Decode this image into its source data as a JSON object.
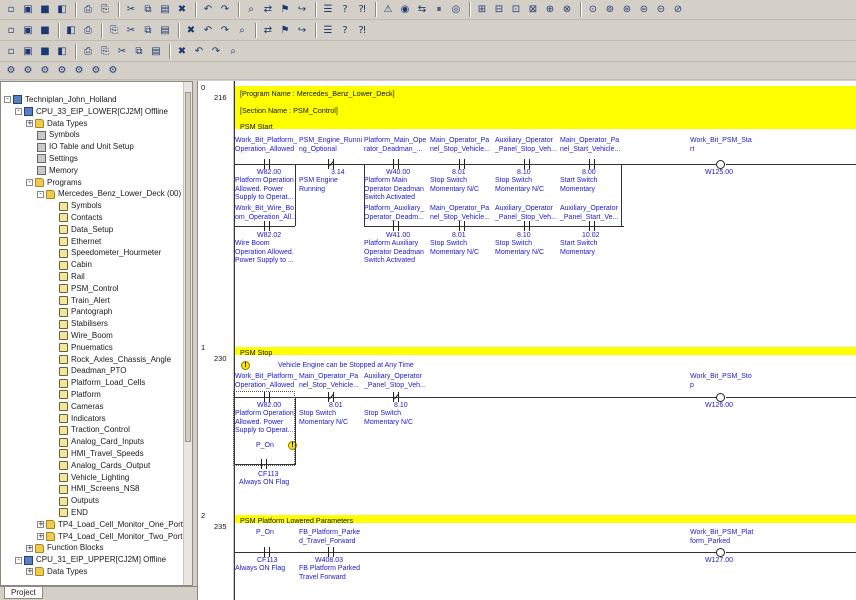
{
  "toolbars": {
    "row1": [
      "new-icon",
      "open-icon",
      "save-icon",
      "print-preview-icon",
      "print-icon",
      "print-setup-icon",
      "cut-icon",
      "copy-icon",
      "paste-icon",
      "delete-icon",
      "undo-icon",
      "redo-icon",
      "find-icon",
      "replace-icon",
      "cross-ref-icon",
      "jump-icon",
      "properties-icon",
      "help-icon",
      "whats-this-icon",
      "warning-icon",
      "monitor-icon",
      "work-online-icon",
      "pause-icon",
      "watch-icon",
      "toggle-a-icon",
      "toggle-b-icon",
      "toggle-c-icon",
      "toggle-d-icon",
      "toggle-e-icon",
      "toggle-f-icon",
      "toggle-g-icon",
      "toggle-h-icon",
      "toggle-i-icon",
      "toggle-j-icon",
      "toggle-k-icon",
      "toggle-l-icon"
    ],
    "row2": [
      "zoom-in-icon",
      "zoom-out-icon",
      "zoom-fit-icon",
      "select-icon",
      "symbol-icon",
      "contact-no-icon",
      "contact-nc-icon",
      "or-no-icon",
      "or-nc-icon",
      "vertical-icon",
      "horizontal-icon",
      "coil-icon",
      "coil-nc-icon",
      "instruction-icon",
      "cursor-icon",
      "pin-icon",
      "rung-icon",
      "dots-icon",
      "settings-icon"
    ],
    "row3": [
      "monitor-mode-icon",
      "online-edit-icon",
      "transfer-icon",
      "compare-icon",
      "run-icon",
      "pause-run-icon",
      "step-icon",
      "stop-icon",
      "trace-icon",
      "force-on-icon",
      "force-off-icon",
      "force-cancel-icon",
      "set-value-icon"
    ]
  },
  "tree": {
    "tab_label": "Project",
    "items": [
      {
        "label": "Techniplan_John_Holland",
        "icon": "project-icon",
        "indent": 0,
        "expander": "-"
      },
      {
        "label": "CPU_33_EIP_LOWER[CJ2M] Offline",
        "icon": "plc-icon",
        "indent": 1,
        "expander": "-"
      },
      {
        "label": "Data Types",
        "icon": "data-types-icon",
        "indent": 2,
        "expander": "+"
      },
      {
        "label": "Symbols",
        "icon": "symbols-icon",
        "indent": 2,
        "expander": ""
      },
      {
        "label": "IO Table and Unit Setup",
        "icon": "io-table-icon",
        "indent": 2,
        "expander": ""
      },
      {
        "label": "Settings",
        "icon": "settings-icon",
        "indent": 2,
        "expander": ""
      },
      {
        "label": "Memory",
        "icon": "memory-icon",
        "indent": 2,
        "expander": ""
      },
      {
        "label": "Programs",
        "icon": "programs-icon",
        "indent": 2,
        "expander": "-"
      },
      {
        "label": "Mercedes_Benz_Lower_Deck (00)",
        "icon": "program-icon",
        "indent": 3,
        "expander": "-"
      },
      {
        "label": "Symbols",
        "icon": "section-icon",
        "indent": 4,
        "expander": ""
      },
      {
        "label": "Contacts",
        "icon": "section-icon",
        "indent": 4,
        "expander": ""
      },
      {
        "label": "Data_Setup",
        "icon": "section-icon",
        "indent": 4,
        "expander": ""
      },
      {
        "label": "Ethernet",
        "icon": "section-icon",
        "indent": 4,
        "expander": ""
      },
      {
        "label": "Speedometer_Hourmeter",
        "icon": "section-icon",
        "indent": 4,
        "expander": ""
      },
      {
        "label": "Cabin",
        "icon": "section-icon",
        "indent": 4,
        "expander": ""
      },
      {
        "label": "Rail",
        "icon": "section-icon",
        "indent": 4,
        "expander": ""
      },
      {
        "label": "PSM_Control",
        "icon": "section-icon",
        "indent": 4,
        "expander": ""
      },
      {
        "label": "Train_Alert",
        "icon": "section-icon",
        "indent": 4,
        "expander": ""
      },
      {
        "label": "Pantograph",
        "icon": "section-icon",
        "indent": 4,
        "expander": ""
      },
      {
        "label": "Stabilisers",
        "icon": "section-icon",
        "indent": 4,
        "expander": ""
      },
      {
        "label": "Wire_Boom",
        "icon": "section-icon",
        "indent": 4,
        "expander": ""
      },
      {
        "label": "Pnuematics",
        "icon": "section-icon",
        "indent": 4,
        "expander": ""
      },
      {
        "label": "Rock_Axles_Chassis_Angle",
        "icon": "section-icon",
        "indent": 4,
        "expander": ""
      },
      {
        "label": "Deadman_PTO",
        "icon": "section-icon",
        "indent": 4,
        "expander": ""
      },
      {
        "label": "Platform_Load_Cells",
        "icon": "section-icon",
        "indent": 4,
        "expander": ""
      },
      {
        "label": "Platform",
        "icon": "section-icon",
        "indent": 4,
        "expander": ""
      },
      {
        "label": "Cameras",
        "icon": "section-icon",
        "indent": 4,
        "expander": ""
      },
      {
        "label": "Indicators",
        "icon": "section-icon",
        "indent": 4,
        "expander": ""
      },
      {
        "label": "Traction_Control",
        "icon": "section-icon",
        "indent": 4,
        "expander": ""
      },
      {
        "label": "Analog_Card_Inputs",
        "icon": "section-icon",
        "indent": 4,
        "expander": ""
      },
      {
        "label": "HMI_Travel_Speeds",
        "icon": "section-icon",
        "indent": 4,
        "expander": ""
      },
      {
        "label": "Analog_Cards_Output",
        "icon": "section-icon",
        "indent": 4,
        "expander": ""
      },
      {
        "label": "Vehicle_Lighting",
        "icon": "section-icon",
        "indent": 4,
        "expander": ""
      },
      {
        "label": "HMI_Screens_NS8",
        "icon": "section-icon",
        "indent": 4,
        "expander": ""
      },
      {
        "label": "Outputs",
        "icon": "section-icon",
        "indent": 4,
        "expander": ""
      },
      {
        "label": "END",
        "icon": "section-icon",
        "indent": 4,
        "expander": ""
      },
      {
        "label": "TP4_Load_Cell_Monitor_One_Port",
        "icon": "program-icon",
        "indent": 3,
        "expander": "+"
      },
      {
        "label": "TP4_Load_Cell_Monitor_Two_Port",
        "icon": "program-icon",
        "indent": 3,
        "expander": "+"
      },
      {
        "label": "Function Blocks",
        "icon": "function-blocks-icon",
        "indent": 2,
        "expander": "+"
      },
      {
        "label": "CPU_31_EIP_UPPER[CJ2M] Offline",
        "icon": "plc-icon",
        "indent": 1,
        "expander": "-"
      },
      {
        "label": "Data Types",
        "icon": "data-types-icon",
        "indent": 2,
        "expander": "+"
      }
    ]
  },
  "ladder": {
    "rung0": {
      "index": "0",
      "step": "216",
      "program_name": "[Program Name : Mercedes_Benz_Lower_Deck]",
      "section_name": "[Section Name : PSM_Control]",
      "title": "PSM Start",
      "row1": [
        {
          "symbol": "Work_Bit_Platform_\nOperation_Allowed",
          "addr": "W82.00",
          "comment": "Platform Operation\nAllowed. Power\nSupply to Operat...",
          "nc": false
        },
        {
          "symbol": "PSM_Engine_Runni\nng_Optional",
          "addr": "3.14",
          "comment": "PSM Engine\nRunning",
          "nc": true
        },
        {
          "symbol": "Platform_Main_Ope\nrator_Deadman_...",
          "addr": "W40.00",
          "comment": "Platform Main\nOperator Deadman\nSwitch Activated",
          "nc": false
        },
        {
          "symbol": "Main_Operator_Pa\nnel_Stop_Vehicle...",
          "addr": "8.01",
          "comment": "Stop Switch\nMomentary N/C",
          "nc": false
        },
        {
          "symbol": "Auxiliary_Operator\n_Panel_Stop_Veh...",
          "addr": "8.10",
          "comment": "Stop Switch\nMomentary N/C",
          "nc": false
        },
        {
          "symbol": "Main_Operator_Pa\nnel_Start_Vehicle...",
          "addr": "8.00",
          "comment": "Start Switch\nMomentary",
          "nc": false
        }
      ],
      "row2": [
        {
          "symbol": "Work_Bit_Wire_Bo\nom_Operation_All...",
          "addr": "W82.02",
          "comment": "Wire Boom\nOperation Allowed.\nPower Supply to ...",
          "nc": false
        },
        {
          "symbol": "Platform_Auxiliary_\nOperator_Deadm...",
          "addr": "W41.00",
          "comment": "Platform Auxiliary\nOperator Deadman\nSwitch Activated",
          "nc": false
        },
        {
          "symbol": "Main_Operator_Pa\nnel_Stop_Vehicle...",
          "addr": "8.01",
          "comment": "Stop Switch\nMomentary N/C",
          "nc": false
        },
        {
          "symbol": "Auxiliary_Operator\n_Panel_Stop_Veh...",
          "addr": "8.10",
          "comment": "Stop Switch\nMomentary N/C",
          "nc": false
        },
        {
          "symbol": "Auxiliary_Operator\n_Panel_Start_Ve...",
          "addr": "10.02",
          "comment": "Start Switch\nMomentary",
          "nc": false
        }
      ],
      "coil": {
        "symbol": "Work_Bit_PSM_Sta\nrt",
        "addr": "W125.00",
        "output": "PSM Start"
      }
    },
    "rung1": {
      "index": "1",
      "step": "230",
      "title": "PSM Stop",
      "note": "Vehicle Engine can be Stopped at Any Time",
      "row1": [
        {
          "symbol": "Work_Bit_Platform_\nOperation_Allowed",
          "addr": "W82.00",
          "comment": "Platform Operation\nAllowed. Power\nSupply to Operat...",
          "nc": false
        },
        {
          "symbol": "Main_Operator_Pa\nnel_Stop_Vehicle...",
          "addr": "8.01",
          "comment": "Stop Switch\nMomentary N/C",
          "nc": true
        },
        {
          "symbol": "Auxiliary_Operator\n_Panel_Stop_Veh...",
          "addr": "8.10",
          "comment": "Stop Switch\nMomentary N/C",
          "nc": true
        }
      ],
      "row2": {
        "symbol": "P_On",
        "addr": "CF113",
        "comment": "Always ON Flag"
      },
      "coil": {
        "symbol": "Work_Bit_PSM_Sto\np",
        "addr": "W126.00",
        "output": "PSM Stop"
      }
    },
    "rung2": {
      "index": "2",
      "step": "235",
      "title": "PSM Platform Lowered Parameters",
      "row1": [
        {
          "symbol": "P_On",
          "addr": "CF113",
          "comment": "Always ON Flag",
          "nc": false
        },
        {
          "symbol": "FB_Platform_Parke\nd_Travel_Forward",
          "addr": "W408.03",
          "comment": "FB Platform Parked\nTravel Forward",
          "nc": false
        }
      ],
      "coil": {
        "symbol": "Work_Bit_PSM_Plat\nform_Parked",
        "addr": "W127.00",
        "output": "Work Bit PSM Platform Parked"
      }
    }
  },
  "colors": {
    "band": "#ffff00",
    "symbol_text": "#1a1acc",
    "background": "#d4d0c8"
  }
}
